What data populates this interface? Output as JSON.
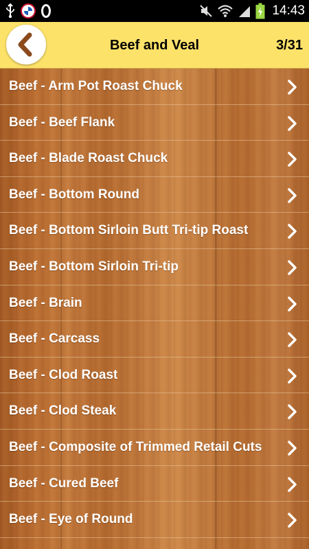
{
  "status_bar": {
    "time": "14:43",
    "left_icons": [
      "usb-icon",
      "fcb-badge-icon",
      "opera-icon"
    ],
    "right_icons": [
      "mute-icon",
      "wifi-icon",
      "signal-icon",
      "battery-charging-icon"
    ]
  },
  "header": {
    "title": "Beef and Veal",
    "counter": "3/31",
    "back_icon": "chevron-left-icon",
    "colors": {
      "header_bg": "#fde26a",
      "back_arrow": "#8b4a1c"
    }
  },
  "list": {
    "items": [
      {
        "label": "Beef - Arm Pot Roast Chuck"
      },
      {
        "label": "Beef - Beef Flank"
      },
      {
        "label": "Beef - Blade Roast Chuck"
      },
      {
        "label": "Beef - Bottom Round"
      },
      {
        "label": "Beef - Bottom Sirloin Butt Tri-tip Roast"
      },
      {
        "label": "Beef - Bottom Sirloin Tri-tip"
      },
      {
        "label": "Beef - Brain"
      },
      {
        "label": "Beef - Carcass"
      },
      {
        "label": "Beef - Clod Roast"
      },
      {
        "label": "Beef - Clod Steak"
      },
      {
        "label": "Beef - Composite of Trimmed Retail Cuts"
      },
      {
        "label": "Beef - Cured Beef"
      },
      {
        "label": "Beef - Eye of Round"
      },
      {
        "label": ""
      }
    ],
    "item_icon": "chevron-right-icon"
  }
}
